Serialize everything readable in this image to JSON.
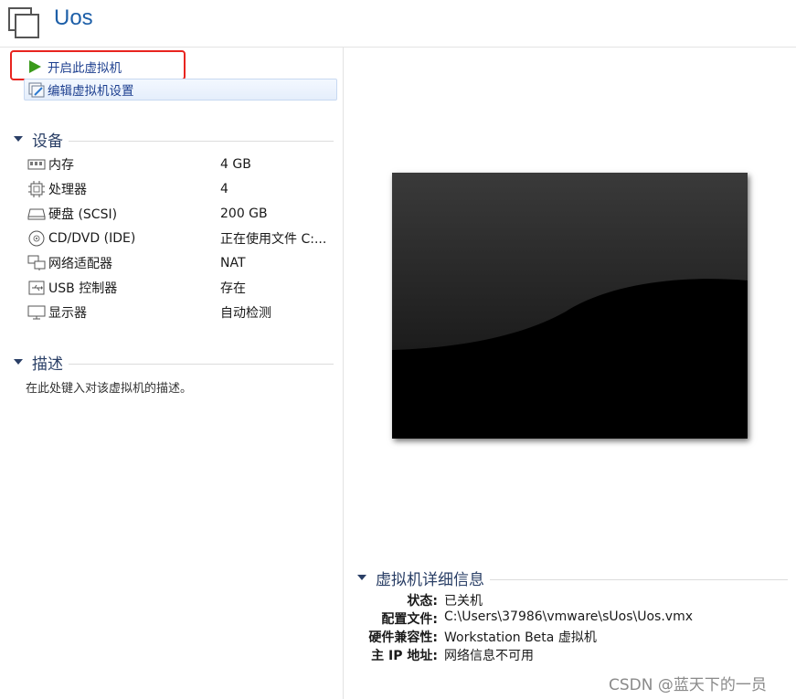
{
  "window": {
    "title": "Uos"
  },
  "actions": {
    "start_label": "开启此虚拟机",
    "edit_label": "编辑虚拟机设置"
  },
  "devices": {
    "section_title": "设备",
    "items": [
      {
        "icon": "memory-icon",
        "name": "内存",
        "value": "4 GB"
      },
      {
        "icon": "processor-icon",
        "name": "处理器",
        "value": "4"
      },
      {
        "icon": "harddisk-icon",
        "name": "硬盘 (SCSI)",
        "value": "200 GB"
      },
      {
        "icon": "cd-dvd-icon",
        "name": "CD/DVD (IDE)",
        "value": "正在使用文件 C:..."
      },
      {
        "icon": "network-adapter-icon",
        "name": "网络适配器",
        "value": "NAT"
      },
      {
        "icon": "usb-icon",
        "name": "USB 控制器",
        "value": "存在"
      },
      {
        "icon": "display-icon",
        "name": "显示器",
        "value": "自动检测"
      }
    ]
  },
  "description": {
    "section_title": "描述",
    "placeholder": "在此处键入对该虚拟机的描述。"
  },
  "details": {
    "section_title": "虚拟机详细信息",
    "rows": [
      {
        "key": "状态:",
        "value": "已关机"
      },
      {
        "key": "配置文件:",
        "value": "C:\\Users\\37986\\vmware\\sUos\\Uos.vmx"
      },
      {
        "key": "硬件兼容性:",
        "value": "Workstation Beta 虚拟机"
      },
      {
        "key": "主 IP 地址:",
        "value": "网络信息不可用"
      }
    ]
  },
  "watermark": "CSDN @蓝天下的一员",
  "colors": {
    "title_blue": "#1d5fa8",
    "link_blue": "#1d3f8f",
    "section_text": "#2a3f66",
    "highlight_red": "#e8241f",
    "play_green": "#3a9a1a"
  }
}
